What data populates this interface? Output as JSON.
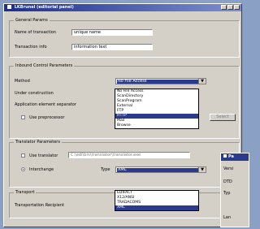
{
  "window": {
    "title": "LKBrunel (editorial panel)"
  },
  "general": {
    "title": "General Params",
    "name_label": "Name of transaction",
    "name_value": "unique name",
    "info_label": "Transaction info",
    "info_value": "information text"
  },
  "control": {
    "title": "Inbound Control Parameters",
    "method_label": "Method",
    "method_value": "No File Access",
    "under_construction_label": "Under construction",
    "app_separator_label": "Application element separator",
    "use_preprocessor_label": "Use preprocessor",
    "button_label": "Select",
    "method_options": [
      "No File Access",
      "ScanDirectory",
      "ScanProgram",
      "External",
      "FTP",
      "HTTP",
      "Mail",
      "Browse"
    ],
    "method_selected_index": 5
  },
  "translator": {
    "title": "Translator Parameters",
    "use_translator_label": "Use translator",
    "use_translator_value": "C:\\edi\\bin\\translator\\translator.exe",
    "interchange_label": "Interchange",
    "type_label": "Type",
    "type_value": "XML",
    "type_options": [
      "EDIFACT",
      "X12/ANSI",
      "TRADACOMS",
      "XML"
    ],
    "type_selected_index": 3
  },
  "transport": {
    "title": "Transport",
    "recipient_label": "Transportation Recipient"
  },
  "sub_window": {
    "title": "Pa",
    "label1": "Versi",
    "label2": "DTD",
    "label3": "Typ",
    "label4": "Lan"
  }
}
